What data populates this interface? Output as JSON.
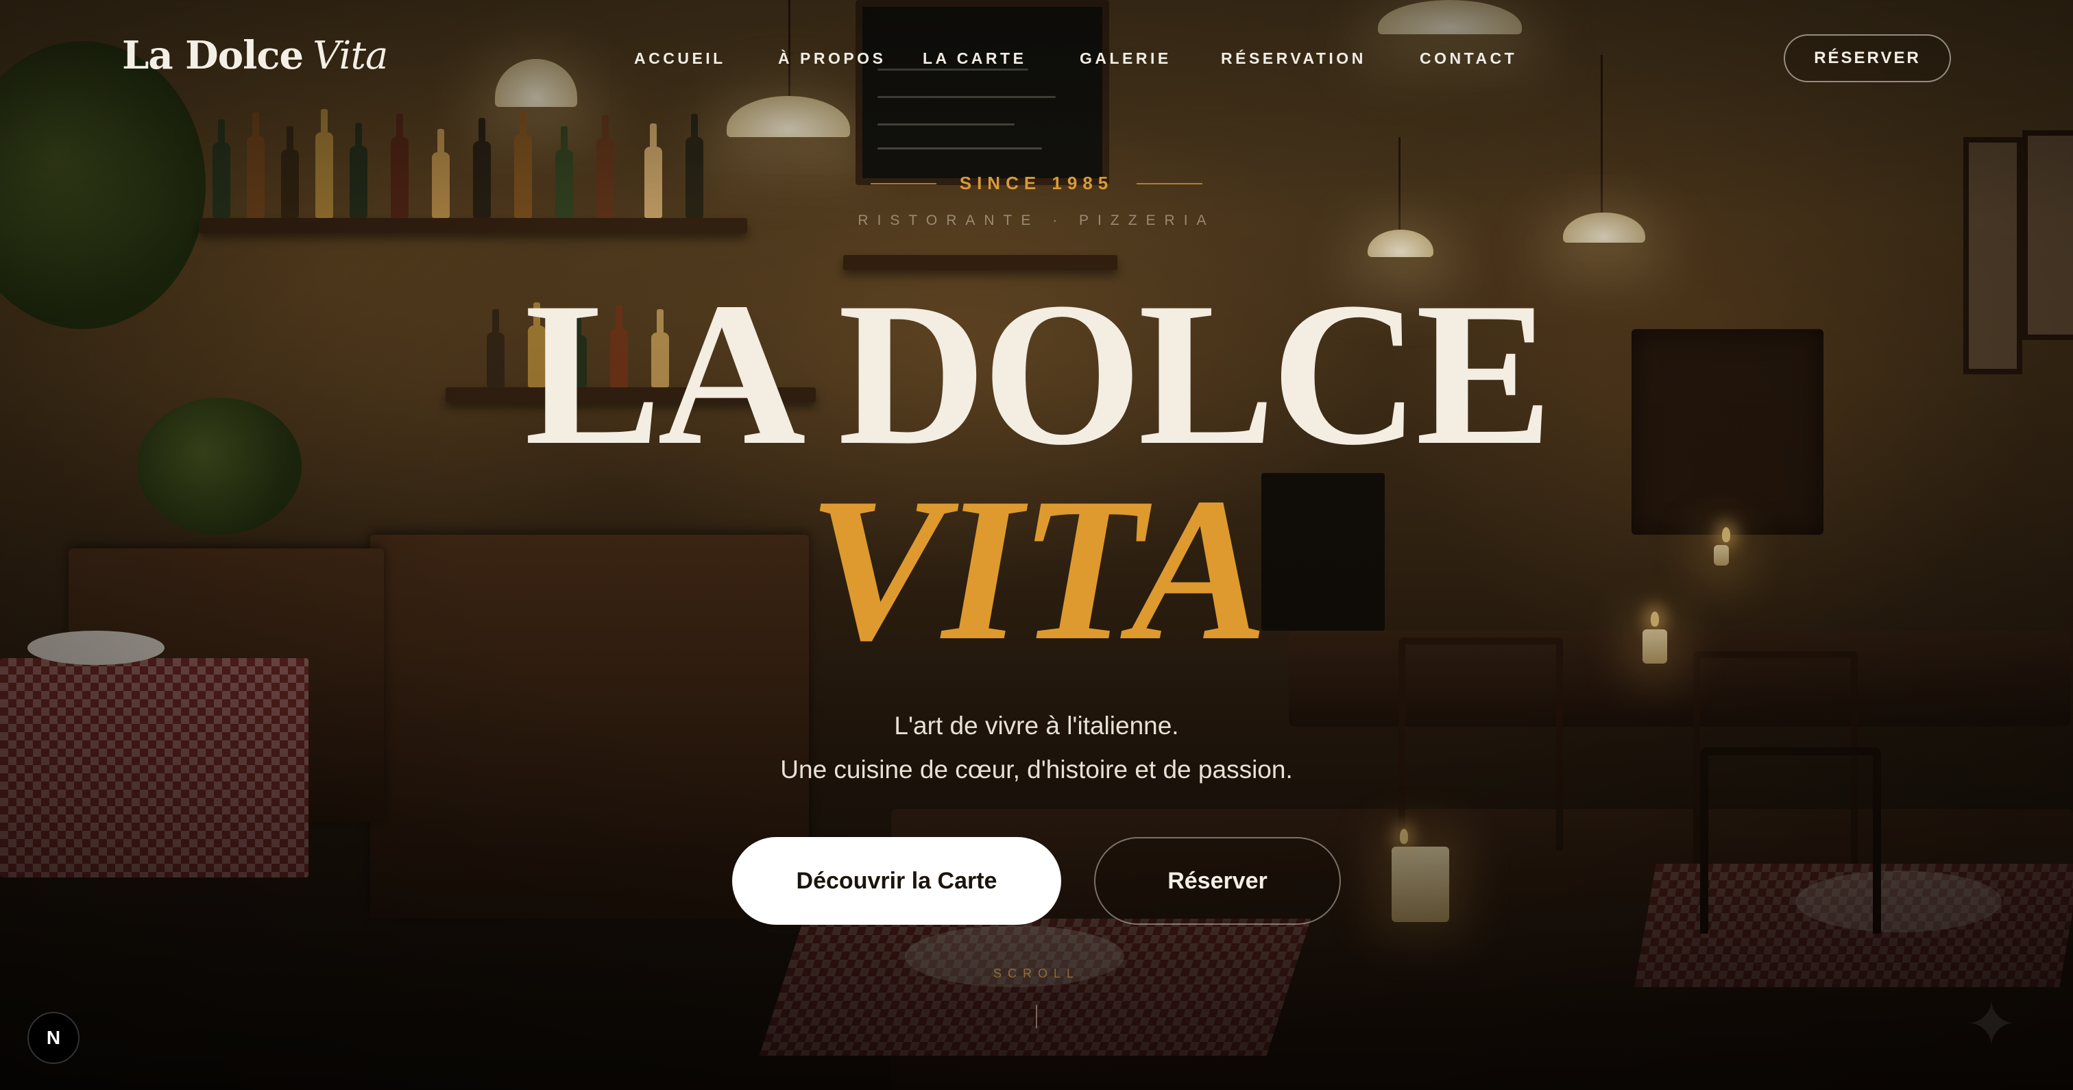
{
  "brand": {
    "name": "La Dolce",
    "name_italic": "Vita"
  },
  "nav": {
    "items": [
      {
        "label": "ACCUEIL"
      },
      {
        "label": "À PROPOS"
      },
      {
        "label": "LA CARTE"
      },
      {
        "label": "GALERIE"
      },
      {
        "label": "RÉSERVATION"
      },
      {
        "label": "CONTACT"
      }
    ],
    "cta_label": "RÉSERVER"
  },
  "hero": {
    "since": "SINCE 1985",
    "tagline": "RISTORANTE · PIZZERIA",
    "title_line1": "LA DOLCE",
    "title_line2": "VITA",
    "subtitle_line1": "L'art de vivre à l'italienne.",
    "subtitle_line2": "Une cuisine de cœur, d'histoire et de passion.",
    "primary_button": "Découvrir la Carte",
    "secondary_button": "Réserver",
    "scroll_label": "SCROLL"
  },
  "dev_badge": {
    "label": "N"
  },
  "colors": {
    "accent_gold": "#de9a2e",
    "text_cream": "#f3ede2",
    "background_dark": "#1a120a"
  },
  "icons": [
    "sparkle-icon"
  ]
}
